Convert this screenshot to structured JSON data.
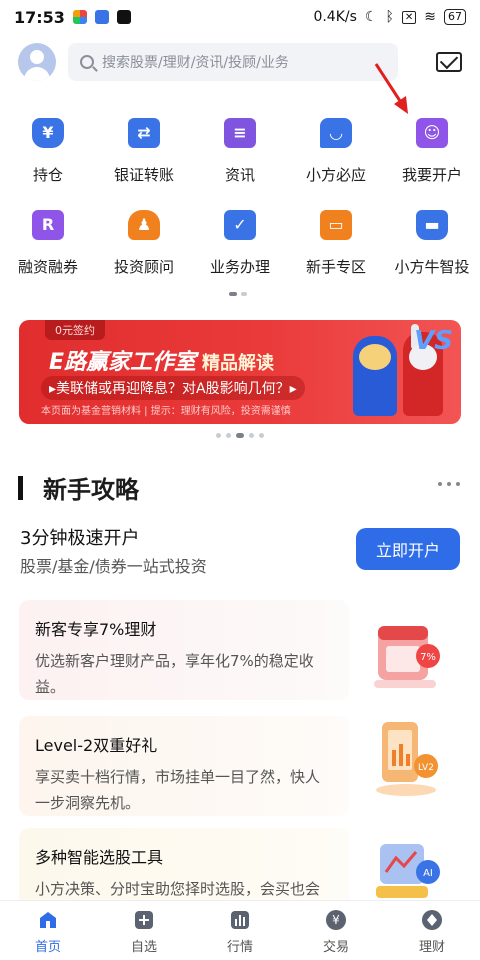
{
  "status_bar": {
    "time": "17:53",
    "net_speed": "0.4K/s",
    "battery": "67"
  },
  "search": {
    "placeholder": "搜索股票/理财/资讯/投顾/业务"
  },
  "grid": [
    {
      "label": "持仓",
      "icon": "wallet-icon",
      "color": "#3a73e6",
      "glyph": "¥"
    },
    {
      "label": "银证转账",
      "icon": "transfer-icon",
      "color": "#3a73e6",
      "glyph": "⇄"
    },
    {
      "label": "资讯",
      "icon": "news-icon",
      "color": "#7f55e0",
      "glyph": "≡"
    },
    {
      "label": "小方必应",
      "icon": "chat-icon",
      "color": "#3a73e6",
      "glyph": "◡"
    },
    {
      "label": "我要开户",
      "icon": "id-card-icon",
      "color": "#8f55e8",
      "glyph": "☺"
    },
    {
      "label": "融资融券",
      "icon": "margin-icon",
      "color": "#8f55e8",
      "glyph": "R"
    },
    {
      "label": "投资顾问",
      "icon": "advisor-icon",
      "color": "#f0811e",
      "glyph": "♟"
    },
    {
      "label": "业务办理",
      "icon": "folder-check-icon",
      "color": "#3a73e6",
      "glyph": "✓"
    },
    {
      "label": "新手专区",
      "icon": "gift-icon",
      "color": "#f0811e",
      "glyph": "▭"
    },
    {
      "label": "小方牛智投",
      "icon": "robot-icon",
      "color": "#3a73e6",
      "glyph": "▬"
    }
  ],
  "banner": {
    "tag": "0元签约",
    "title": "E路赢家工作室",
    "title_suffix": "精品解读",
    "line": "▸美联储或再迎降息？对A股影响几何？▸",
    "note": "本页面为基金营销材料 | 提示：理财有风险，投资需谨慎",
    "vs": "VS"
  },
  "guide": {
    "title": "新手攻略",
    "open_title": "3分钟极速开户",
    "open_sub": "股票/基金/债券一站式投资",
    "open_button": "立即开户",
    "cards": [
      {
        "title": "新客专享7%理财",
        "desc": "优选新客户理财产品，享年化7%的稳定收益。",
        "badge": "7%"
      },
      {
        "title": "Level-2双重好礼",
        "desc": "享买卖十档行情，市场挂单一目了然，快人一步洞察先机。",
        "badge": "LV2"
      },
      {
        "title": "多种智能选股工具",
        "desc": "小方决策、分时宝助您择时选股，会买也会卖，才能赢得赚",
        "badge": "AI"
      }
    ]
  },
  "tabs": [
    {
      "label": "首页",
      "icon": "home-icon",
      "active": true
    },
    {
      "label": "自选",
      "icon": "plus-square-icon",
      "active": false
    },
    {
      "label": "行情",
      "icon": "bar-chart-icon",
      "active": false
    },
    {
      "label": "交易",
      "icon": "yuan-circle-icon",
      "active": false
    },
    {
      "label": "理财",
      "icon": "diamond-icon",
      "active": false
    }
  ],
  "colors": {
    "accent": "#2f6de8",
    "banner_red": "#e12d2d",
    "annotation_arrow": "#e0201e"
  }
}
